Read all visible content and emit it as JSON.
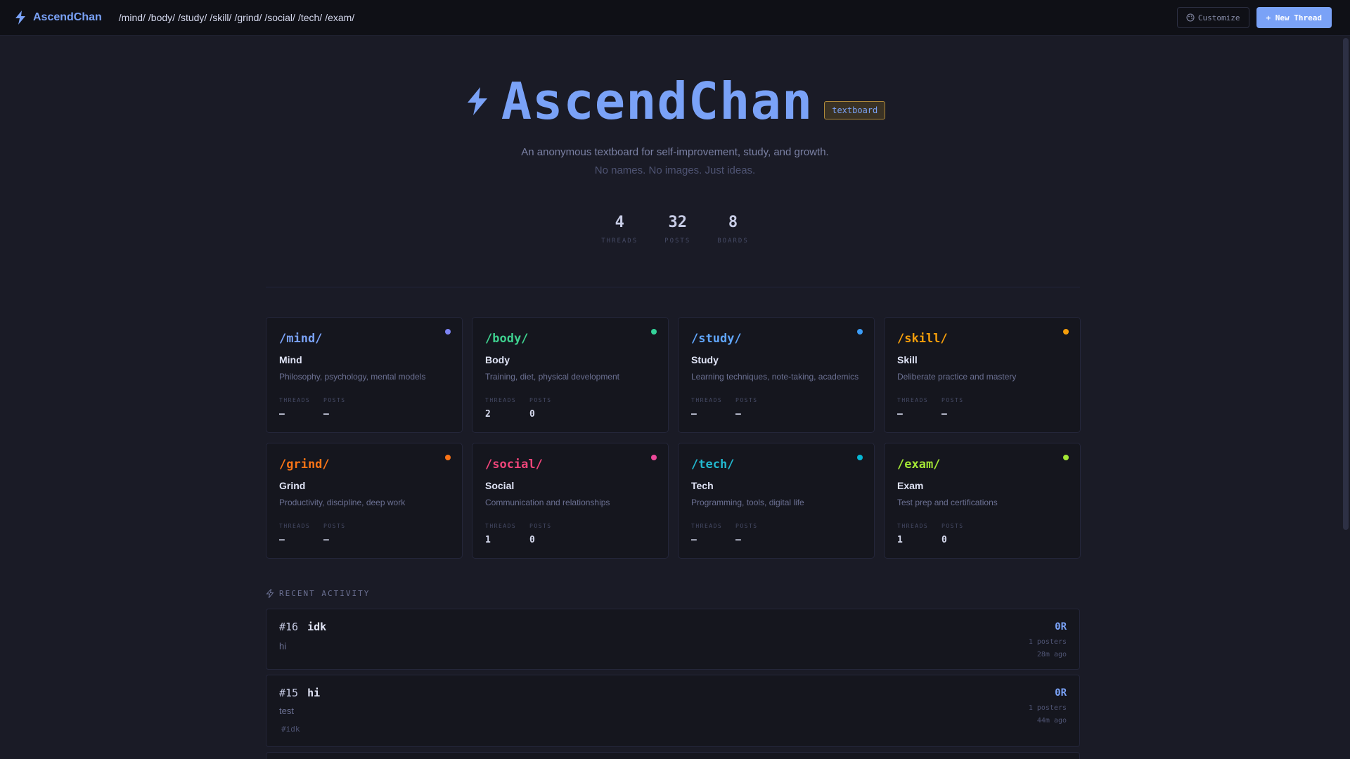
{
  "topbar": {
    "brand": "AscendChan",
    "nav": [
      "/mind/",
      "/body/",
      "/study/",
      "/skill/",
      "/grind/",
      "/social/",
      "/tech/",
      "/exam/"
    ],
    "customize_label": "Customize",
    "new_thread_label": "+ New Thread"
  },
  "hero": {
    "title": "AscendChan",
    "badge": "textboard",
    "tagline": "An anonymous textboard for self-improvement, study, and growth.",
    "subtagline": "No names. No images. Just ideas."
  },
  "stats": [
    {
      "value": "4",
      "label": "THREADS"
    },
    {
      "value": "32",
      "label": "POSTS"
    },
    {
      "value": "8",
      "label": "BOARDS"
    }
  ],
  "boards": [
    {
      "slug": "/mind/",
      "name": "Mind",
      "desc": "Philosophy, psychology, mental models",
      "threads": "—",
      "posts": "—",
      "color": "#7aa2f7",
      "dot": "#7c83f3"
    },
    {
      "slug": "/body/",
      "name": "Body",
      "desc": "Training, diet, physical development",
      "threads": "2",
      "posts": "0",
      "color": "#3ecf8e",
      "dot": "#34d399"
    },
    {
      "slug": "/study/",
      "name": "Study",
      "desc": "Learning techniques, note-taking, academics",
      "threads": "—",
      "posts": "—",
      "color": "#60a5fa",
      "dot": "#3b9cf6"
    },
    {
      "slug": "/skill/",
      "name": "Skill",
      "desc": "Deliberate practice and mastery",
      "threads": "—",
      "posts": "—",
      "color": "#f59e0b",
      "dot": "#f59e0b"
    },
    {
      "slug": "/grind/",
      "name": "Grind",
      "desc": "Productivity, discipline, deep work",
      "threads": "—",
      "posts": "—",
      "color": "#f97316",
      "dot": "#f97316"
    },
    {
      "slug": "/social/",
      "name": "Social",
      "desc": "Communication and relationships",
      "threads": "1",
      "posts": "0",
      "color": "#f0457a",
      "dot": "#ec4899"
    },
    {
      "slug": "/tech/",
      "name": "Tech",
      "desc": "Programming, tools, digital life",
      "threads": "—",
      "posts": "—",
      "color": "#22b8cf",
      "dot": "#06b6d4"
    },
    {
      "slug": "/exam/",
      "name": "Exam",
      "desc": "Test prep and certifications",
      "threads": "1",
      "posts": "0",
      "color": "#a3e635",
      "dot": "#a3e635"
    }
  ],
  "card_labels": {
    "threads": "THREADS",
    "posts": "POSTS"
  },
  "recent": {
    "title": "RECENT ACTIVITY",
    "threads": [
      {
        "id": "#16",
        "subject": "idk",
        "body": "hi",
        "tag": "",
        "replies": "0R",
        "posters": "1 posters",
        "time": "28m ago"
      },
      {
        "id": "#15",
        "subject": "hi",
        "body": "test",
        "tag": "#idk",
        "replies": "0R",
        "posters": "1 posters",
        "time": "44m ago"
      }
    ]
  },
  "icons": {
    "brand": "bolt-icon",
    "customize": "palette-icon",
    "recent": "bolt-outline-icon"
  },
  "colors": {
    "accent": "#7aa2f7",
    "background": "#1a1b26",
    "card": "#15161e",
    "topbar": "#0f1016"
  }
}
